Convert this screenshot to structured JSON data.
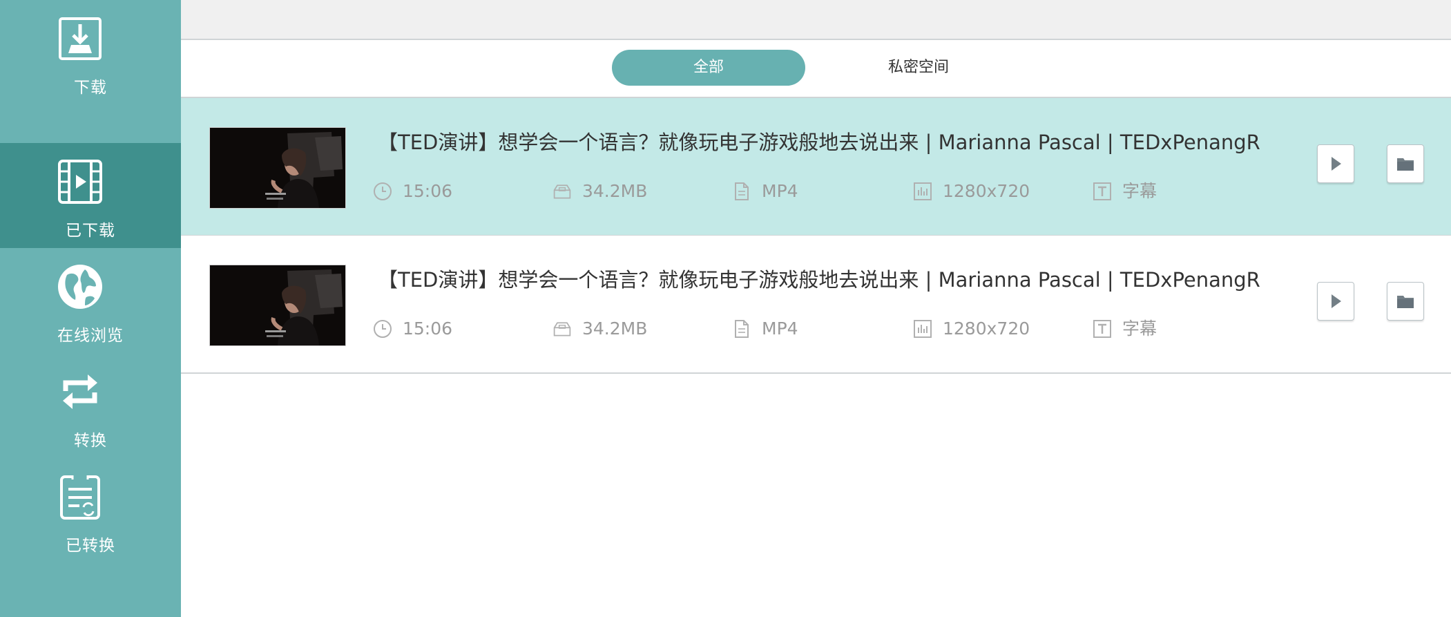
{
  "sidebar": {
    "items": [
      {
        "label": "下载",
        "icon": "download-icon",
        "active": false
      },
      {
        "label": "已下载",
        "icon": "film-icon",
        "active": true
      },
      {
        "label": "在线浏览",
        "icon": "globe-icon",
        "active": false
      },
      {
        "label": "转换",
        "icon": "convert-icon",
        "active": false
      },
      {
        "label": "已转换",
        "icon": "converted-doc-icon",
        "active": false
      }
    ]
  },
  "tabs": {
    "all": "全部",
    "private": "私密空间",
    "selected": "全部"
  },
  "videos": [
    {
      "title": "【TED演讲】想学会一个语言？就像玩电子游戏般地去说出来 | Marianna Pascal | TEDxPenangRo",
      "duration": "15:06",
      "size": "34.2MB",
      "format": "MP4",
      "resolution": "1280x720",
      "subtitle": "字幕",
      "selected": true
    },
    {
      "title": "【TED演讲】想学会一个语言？就像玩电子游戏般地去说出来 | Marianna Pascal | TEDxPenangRo",
      "duration": "15:06",
      "size": "34.2MB",
      "format": "MP4",
      "resolution": "1280x720",
      "subtitle": "字幕",
      "selected": false
    }
  ],
  "colors": {
    "sidebar": "#6ab3b3",
    "sidebar_active": "#3f908d",
    "accent": "#67b1b1",
    "row_selected": "#c3e9e7",
    "meta_text": "#9a9a9a"
  }
}
